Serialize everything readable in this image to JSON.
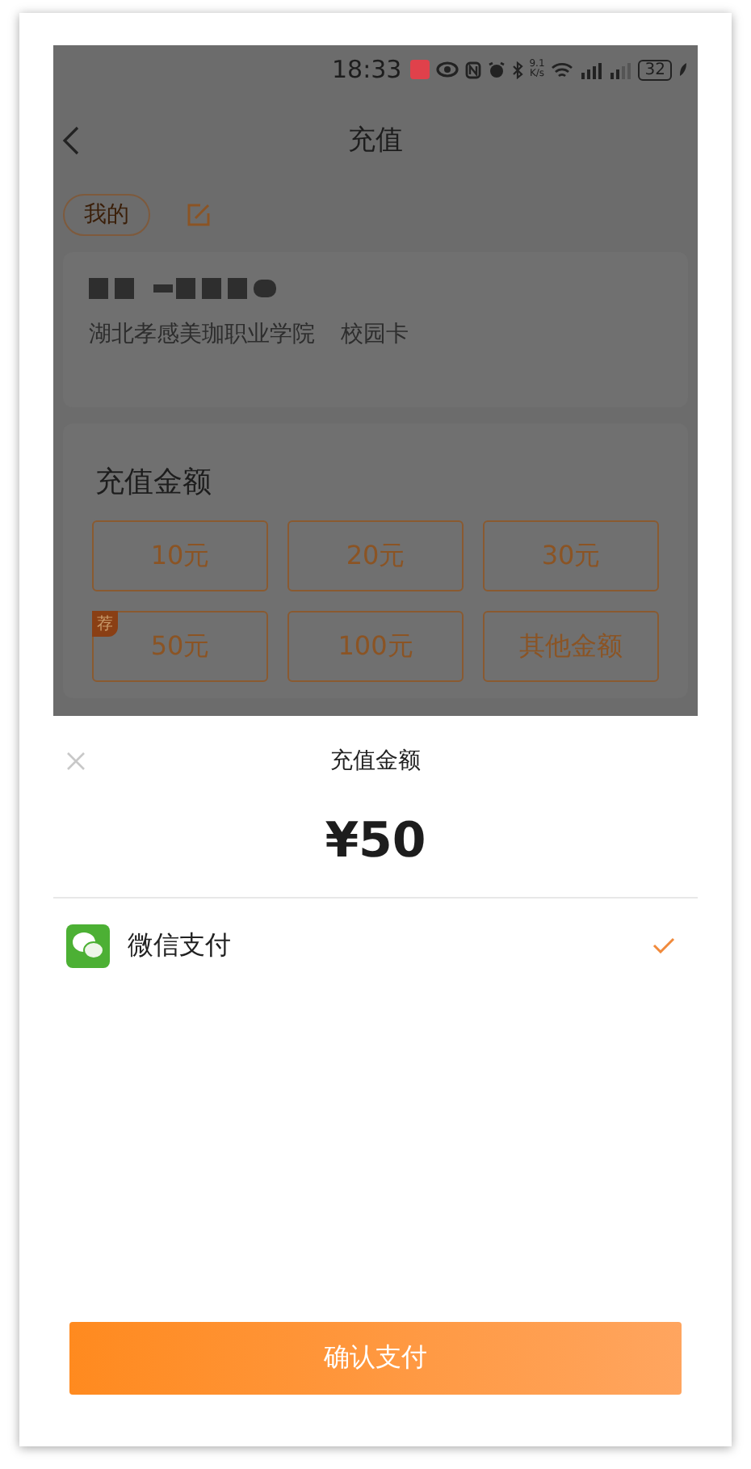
{
  "status_bar": {
    "time": "18:33",
    "speed": "9.1\nK/s",
    "battery": "32"
  },
  "header": {
    "title": "充值"
  },
  "tags": [
    {
      "label": "我的"
    }
  ],
  "card": {
    "school": "湖北孝感美珈职业学院",
    "card_type": "校园卡"
  },
  "recharge": {
    "title": "充值金额",
    "amounts": [
      {
        "label": "10元"
      },
      {
        "label": "20元"
      },
      {
        "label": "30元"
      },
      {
        "label": "50元",
        "badge": "荐"
      },
      {
        "label": "100元"
      },
      {
        "label": "其他金额"
      }
    ]
  },
  "sheet": {
    "title": "充值金额",
    "amount": "¥50",
    "methods": [
      {
        "name": "微信支付",
        "selected": true
      }
    ],
    "confirm": "确认支付"
  }
}
